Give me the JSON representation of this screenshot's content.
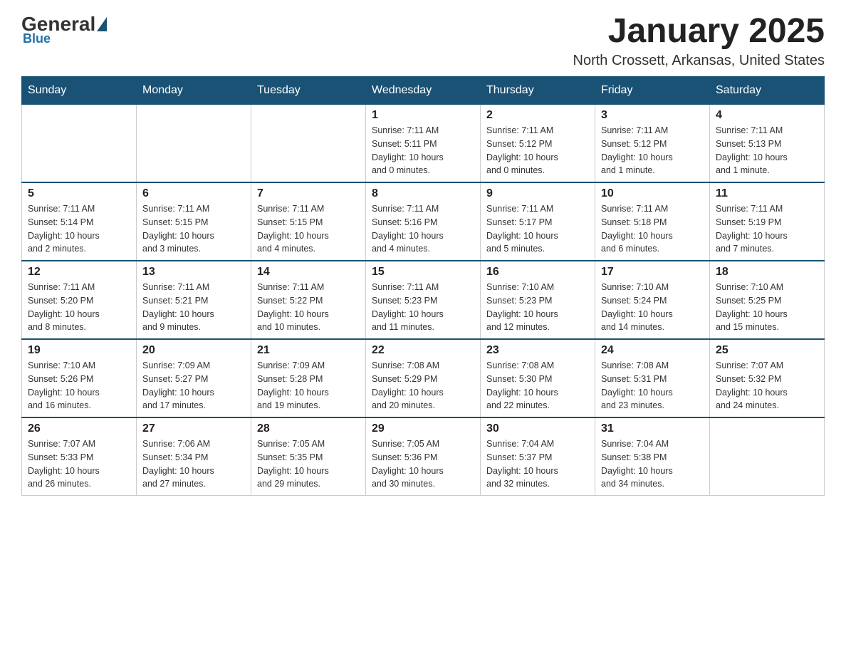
{
  "header": {
    "logo_general": "General",
    "logo_blue": "Blue",
    "month_title": "January 2025",
    "location": "North Crossett, Arkansas, United States"
  },
  "days_of_week": [
    "Sunday",
    "Monday",
    "Tuesday",
    "Wednesday",
    "Thursday",
    "Friday",
    "Saturday"
  ],
  "weeks": [
    [
      {
        "day": "",
        "info": ""
      },
      {
        "day": "",
        "info": ""
      },
      {
        "day": "",
        "info": ""
      },
      {
        "day": "1",
        "info": "Sunrise: 7:11 AM\nSunset: 5:11 PM\nDaylight: 10 hours\nand 0 minutes."
      },
      {
        "day": "2",
        "info": "Sunrise: 7:11 AM\nSunset: 5:12 PM\nDaylight: 10 hours\nand 0 minutes."
      },
      {
        "day": "3",
        "info": "Sunrise: 7:11 AM\nSunset: 5:12 PM\nDaylight: 10 hours\nand 1 minute."
      },
      {
        "day": "4",
        "info": "Sunrise: 7:11 AM\nSunset: 5:13 PM\nDaylight: 10 hours\nand 1 minute."
      }
    ],
    [
      {
        "day": "5",
        "info": "Sunrise: 7:11 AM\nSunset: 5:14 PM\nDaylight: 10 hours\nand 2 minutes."
      },
      {
        "day": "6",
        "info": "Sunrise: 7:11 AM\nSunset: 5:15 PM\nDaylight: 10 hours\nand 3 minutes."
      },
      {
        "day": "7",
        "info": "Sunrise: 7:11 AM\nSunset: 5:15 PM\nDaylight: 10 hours\nand 4 minutes."
      },
      {
        "day": "8",
        "info": "Sunrise: 7:11 AM\nSunset: 5:16 PM\nDaylight: 10 hours\nand 4 minutes."
      },
      {
        "day": "9",
        "info": "Sunrise: 7:11 AM\nSunset: 5:17 PM\nDaylight: 10 hours\nand 5 minutes."
      },
      {
        "day": "10",
        "info": "Sunrise: 7:11 AM\nSunset: 5:18 PM\nDaylight: 10 hours\nand 6 minutes."
      },
      {
        "day": "11",
        "info": "Sunrise: 7:11 AM\nSunset: 5:19 PM\nDaylight: 10 hours\nand 7 minutes."
      }
    ],
    [
      {
        "day": "12",
        "info": "Sunrise: 7:11 AM\nSunset: 5:20 PM\nDaylight: 10 hours\nand 8 minutes."
      },
      {
        "day": "13",
        "info": "Sunrise: 7:11 AM\nSunset: 5:21 PM\nDaylight: 10 hours\nand 9 minutes."
      },
      {
        "day": "14",
        "info": "Sunrise: 7:11 AM\nSunset: 5:22 PM\nDaylight: 10 hours\nand 10 minutes."
      },
      {
        "day": "15",
        "info": "Sunrise: 7:11 AM\nSunset: 5:23 PM\nDaylight: 10 hours\nand 11 minutes."
      },
      {
        "day": "16",
        "info": "Sunrise: 7:10 AM\nSunset: 5:23 PM\nDaylight: 10 hours\nand 12 minutes."
      },
      {
        "day": "17",
        "info": "Sunrise: 7:10 AM\nSunset: 5:24 PM\nDaylight: 10 hours\nand 14 minutes."
      },
      {
        "day": "18",
        "info": "Sunrise: 7:10 AM\nSunset: 5:25 PM\nDaylight: 10 hours\nand 15 minutes."
      }
    ],
    [
      {
        "day": "19",
        "info": "Sunrise: 7:10 AM\nSunset: 5:26 PM\nDaylight: 10 hours\nand 16 minutes."
      },
      {
        "day": "20",
        "info": "Sunrise: 7:09 AM\nSunset: 5:27 PM\nDaylight: 10 hours\nand 17 minutes."
      },
      {
        "day": "21",
        "info": "Sunrise: 7:09 AM\nSunset: 5:28 PM\nDaylight: 10 hours\nand 19 minutes."
      },
      {
        "day": "22",
        "info": "Sunrise: 7:08 AM\nSunset: 5:29 PM\nDaylight: 10 hours\nand 20 minutes."
      },
      {
        "day": "23",
        "info": "Sunrise: 7:08 AM\nSunset: 5:30 PM\nDaylight: 10 hours\nand 22 minutes."
      },
      {
        "day": "24",
        "info": "Sunrise: 7:08 AM\nSunset: 5:31 PM\nDaylight: 10 hours\nand 23 minutes."
      },
      {
        "day": "25",
        "info": "Sunrise: 7:07 AM\nSunset: 5:32 PM\nDaylight: 10 hours\nand 24 minutes."
      }
    ],
    [
      {
        "day": "26",
        "info": "Sunrise: 7:07 AM\nSunset: 5:33 PM\nDaylight: 10 hours\nand 26 minutes."
      },
      {
        "day": "27",
        "info": "Sunrise: 7:06 AM\nSunset: 5:34 PM\nDaylight: 10 hours\nand 27 minutes."
      },
      {
        "day": "28",
        "info": "Sunrise: 7:05 AM\nSunset: 5:35 PM\nDaylight: 10 hours\nand 29 minutes."
      },
      {
        "day": "29",
        "info": "Sunrise: 7:05 AM\nSunset: 5:36 PM\nDaylight: 10 hours\nand 30 minutes."
      },
      {
        "day": "30",
        "info": "Sunrise: 7:04 AM\nSunset: 5:37 PM\nDaylight: 10 hours\nand 32 minutes."
      },
      {
        "day": "31",
        "info": "Sunrise: 7:04 AM\nSunset: 5:38 PM\nDaylight: 10 hours\nand 34 minutes."
      },
      {
        "day": "",
        "info": ""
      }
    ]
  ]
}
